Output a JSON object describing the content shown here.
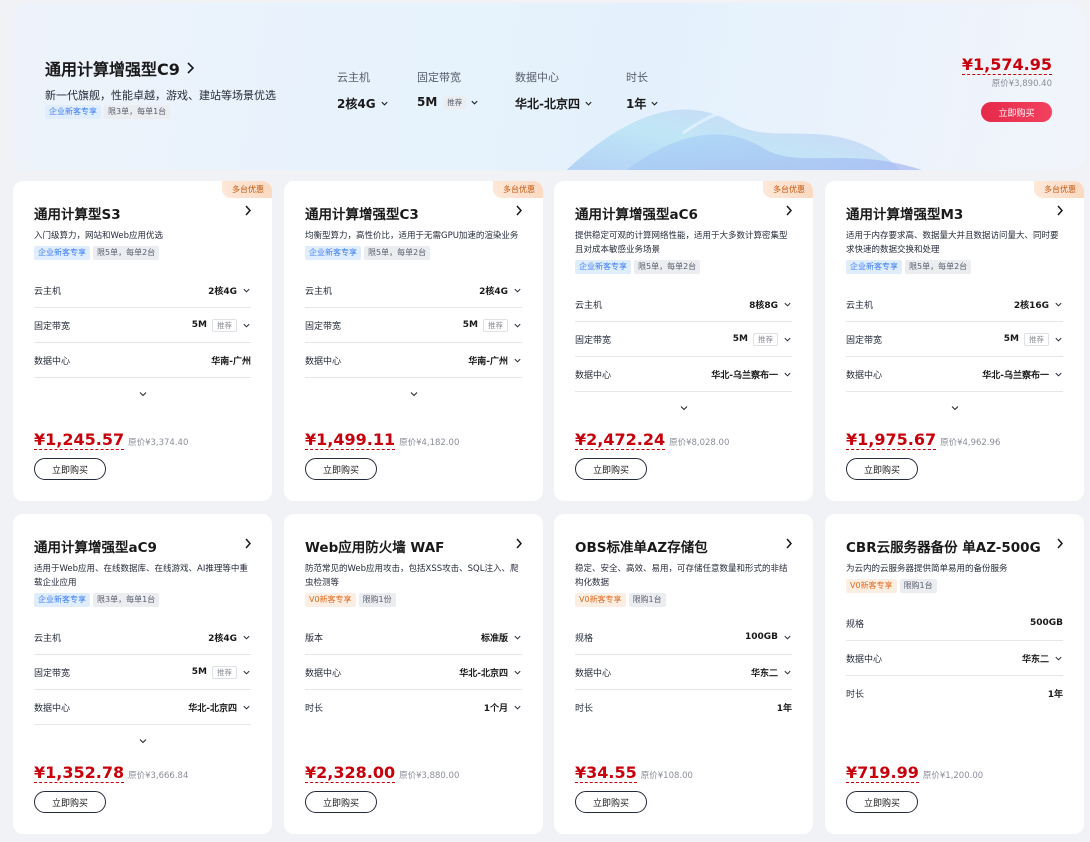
{
  "hero": {
    "title": "通用计算增强型C9",
    "subtitle": "新一代旗舰，性能卓越，游戏、建站等场景优选",
    "tags": [
      "企业新客专享",
      "限3单，每单1台"
    ],
    "specs": [
      {
        "label": "云主机",
        "value": "2核4G",
        "tag": ""
      },
      {
        "label": "固定带宽",
        "value": "5M",
        "tag": "推荐"
      },
      {
        "label": "数据中心",
        "value": "华北-北京四",
        "tag": ""
      },
      {
        "label": "时长",
        "value": "1年",
        "tag": ""
      }
    ],
    "price": "¥1,574.95",
    "original": "原价¥3,890.40",
    "buy": "立即购买"
  },
  "cards": [
    {
      "badge": "多台优惠",
      "title": "通用计算型S3",
      "desc": "入门级算力，网站和Web应用优选",
      "tags": [
        {
          "text": "企业新客专享",
          "color": "blue"
        },
        {
          "text": "限5单，每单2台",
          "color": "gray"
        }
      ],
      "rows": [
        {
          "label": "云主机",
          "value": "2核4G",
          "tag": "",
          "chevron": true
        },
        {
          "label": "固定带宽",
          "value": "5M",
          "tag": "推荐",
          "chevron": true
        },
        {
          "label": "数据中心",
          "value": "华南-广州",
          "tag": "",
          "chevron": false
        }
      ],
      "expand": true,
      "price": "¥1,245.57",
      "original": "原价¥3,374.40",
      "buy": "立即购买"
    },
    {
      "badge": "多台优惠",
      "title": "通用计算增强型C3",
      "desc": "均衡型算力，高性价比，适用于无需GPU加速的渲染业务",
      "tags": [
        {
          "text": "企业新客专享",
          "color": "blue"
        },
        {
          "text": "限5单，每单2台",
          "color": "gray"
        }
      ],
      "rows": [
        {
          "label": "云主机",
          "value": "2核4G",
          "tag": "",
          "chevron": true
        },
        {
          "label": "固定带宽",
          "value": "5M",
          "tag": "推荐",
          "chevron": true
        },
        {
          "label": "数据中心",
          "value": "华南-广州",
          "tag": "",
          "chevron": true
        }
      ],
      "expand": true,
      "price": "¥1,499.11",
      "original": "原价¥4,182.00",
      "buy": "立即购买"
    },
    {
      "badge": "多台优惠",
      "title": "通用计算增强型aC6",
      "desc": "提供稳定可观的计算网络性能，适用于大多数计算密集型且对成本敏感业务场景",
      "tags": [
        {
          "text": "企业新客专享",
          "color": "blue"
        },
        {
          "text": "限5单，每单2台",
          "color": "gray"
        }
      ],
      "rows": [
        {
          "label": "云主机",
          "value": "8核8G",
          "tag": "",
          "chevron": true
        },
        {
          "label": "固定带宽",
          "value": "5M",
          "tag": "推荐",
          "chevron": true
        },
        {
          "label": "数据中心",
          "value": "华北-乌兰察布一",
          "tag": "",
          "chevron": true
        }
      ],
      "expand": true,
      "price": "¥2,472.24",
      "original": "原价¥8,028.00",
      "buy": "立即购买"
    },
    {
      "badge": "多台优惠",
      "title": "通用计算增强型M3",
      "desc": "适用于内存要求高、数据量大并且数据访问量大、同时要求快速的数据交换和处理",
      "tags": [
        {
          "text": "企业新客专享",
          "color": "blue"
        },
        {
          "text": "限5单，每单2台",
          "color": "gray"
        }
      ],
      "rows": [
        {
          "label": "云主机",
          "value": "2核16G",
          "tag": "",
          "chevron": true
        },
        {
          "label": "固定带宽",
          "value": "5M",
          "tag": "推荐",
          "chevron": true
        },
        {
          "label": "数据中心",
          "value": "华北-乌兰察布一",
          "tag": "",
          "chevron": true
        }
      ],
      "expand": true,
      "price": "¥1,975.67",
      "original": "原价¥4,962.96",
      "buy": "立即购买"
    },
    {
      "badge": "",
      "title": "通用计算增强型aC9",
      "desc": "适用于Web应用、在线数据库、在线游戏、AI推理等中重载企业应用",
      "tags": [
        {
          "text": "企业新客专享",
          "color": "blue"
        },
        {
          "text": "限3单，每单1台",
          "color": "gray"
        }
      ],
      "rows": [
        {
          "label": "云主机",
          "value": "2核4G",
          "tag": "",
          "chevron": true
        },
        {
          "label": "固定带宽",
          "value": "5M",
          "tag": "推荐",
          "chevron": true
        },
        {
          "label": "数据中心",
          "value": "华北-北京四",
          "tag": "",
          "chevron": true
        }
      ],
      "expand": true,
      "price": "¥1,352.78",
      "original": "原价¥3,666.84",
      "buy": "立即购买"
    },
    {
      "badge": "",
      "title": "Web应用防火墙 WAF",
      "desc": "防范常见的Web应用攻击，包括XSS攻击、SQL注入、爬虫检测等",
      "tags": [
        {
          "text": "V0新客专享",
          "color": "orange"
        },
        {
          "text": "限购1份",
          "color": "gray"
        }
      ],
      "rows": [
        {
          "label": "版本",
          "value": "标准版",
          "tag": "",
          "chevron": true
        },
        {
          "label": "数据中心",
          "value": "华北-北京四",
          "tag": "",
          "chevron": true
        },
        {
          "label": "时长",
          "value": "1个月",
          "tag": "",
          "chevron": true
        }
      ],
      "expand": false,
      "price": "¥2,328.00",
      "original": "原价¥3,880.00",
      "buy": "立即购买"
    },
    {
      "badge": "",
      "title": "OBS标准单AZ存储包",
      "desc": "稳定、安全、高效、易用，可存储任意数量和形式的非结构化数据",
      "tags": [
        {
          "text": "V0新客专享",
          "color": "orange"
        },
        {
          "text": "限购1台",
          "color": "gray"
        }
      ],
      "rows": [
        {
          "label": "规格",
          "value": "100GB",
          "tag": "",
          "chevron": true
        },
        {
          "label": "数据中心",
          "value": "华东二",
          "tag": "",
          "chevron": true
        },
        {
          "label": "时长",
          "value": "1年",
          "tag": "",
          "chevron": false
        }
      ],
      "expand": false,
      "price": "¥34.55",
      "original": "原价¥108.00",
      "buy": "立即购买"
    },
    {
      "badge": "",
      "title": "CBR云服务器备份 单AZ-500G",
      "desc": "为云内的云服务器提供简单易用的备份服务",
      "tags": [
        {
          "text": "V0新客专享",
          "color": "orange"
        },
        {
          "text": "限购1台",
          "color": "gray"
        }
      ],
      "rows": [
        {
          "label": "规格",
          "value": "500GB",
          "tag": "",
          "chevron": false
        },
        {
          "label": "数据中心",
          "value": "华东二",
          "tag": "",
          "chevron": true
        },
        {
          "label": "时长",
          "value": "1年",
          "tag": "",
          "chevron": false
        }
      ],
      "expand": false,
      "price": "¥719.99",
      "original": "原价¥1,200.00",
      "buy": "立即购买"
    }
  ]
}
